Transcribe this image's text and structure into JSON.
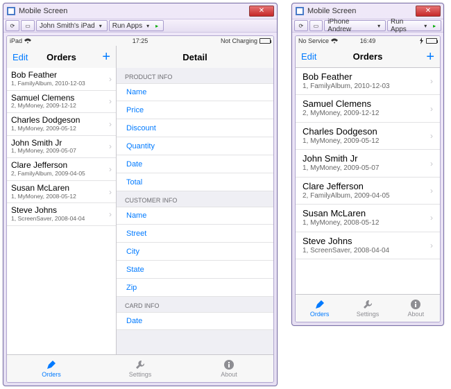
{
  "windows": {
    "ipad": {
      "title": "Mobile Screen",
      "device_label": "John Smith's iPad",
      "run_label": "Run Apps",
      "status": {
        "left": "iPad",
        "wifi": "wifi-icon",
        "mid": "17:25",
        "right": "Not Charging",
        "battery_pct": 80,
        "battery_color": "black"
      },
      "master_nav": {
        "left": "Edit",
        "title": "Orders",
        "right_icon": "plus-icon"
      },
      "detail_nav": {
        "title": "Detail"
      }
    },
    "iphone": {
      "title": "Mobile Screen",
      "device_label": "iPhone Andrew",
      "run_label": "Run Apps",
      "status": {
        "left": "No Service",
        "wifi": "wifi-icon",
        "mid": "16:49",
        "right_icon": "bolt-icon",
        "battery_pct": 95,
        "battery_color": "green"
      },
      "nav": {
        "left": "Edit",
        "title": "Orders",
        "right_icon": "plus-icon"
      }
    }
  },
  "orders": [
    {
      "name": "Bob Feather",
      "sub": "1, FamilyAlbum, 2010-12-03"
    },
    {
      "name": "Samuel Clemens",
      "sub": "2, MyMoney, 2009-12-12"
    },
    {
      "name": "Charles Dodgeson",
      "sub": "1, MyMoney, 2009-05-12"
    },
    {
      "name": "John Smith Jr",
      "sub": "1, MyMoney, 2009-05-07"
    },
    {
      "name": "Clare Jefferson",
      "sub": "2, FamilyAlbum, 2009-04-05"
    },
    {
      "name": "Susan McLaren",
      "sub": "1, MyMoney, 2008-05-12"
    },
    {
      "name": "Steve Johns",
      "sub": "1, ScreenSaver, 2008-04-04"
    }
  ],
  "detail": {
    "sections": [
      {
        "header": "PRODUCT INFO",
        "fields": [
          "Name",
          "Price",
          "Discount",
          "Quantity",
          "Date",
          "Total"
        ]
      },
      {
        "header": "CUSTOMER INFO",
        "fields": [
          "Name",
          "Street",
          "City",
          "State",
          "Zip"
        ]
      },
      {
        "header": "CARD INFO",
        "fields": [
          "Date"
        ]
      }
    ]
  },
  "tabs": [
    {
      "label": "Orders",
      "icon": "pencil-icon",
      "active": true
    },
    {
      "label": "Settings",
      "icon": "wrench-icon",
      "active": false
    },
    {
      "label": "About",
      "icon": "info-icon",
      "active": false
    }
  ]
}
